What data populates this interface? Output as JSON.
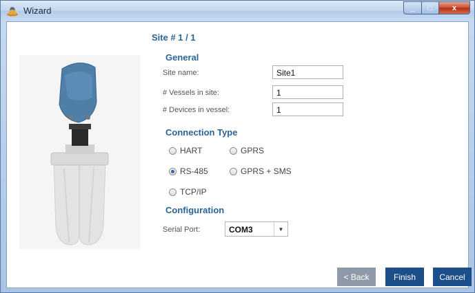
{
  "window": {
    "title": "Wizard",
    "close_glyph": "x",
    "maximize_glyph": "□",
    "minimize_glyph": "_"
  },
  "site_title": "Site # 1 / 1",
  "general": {
    "heading": "General",
    "site_name_label": "Site name:",
    "site_name_value": "Site1",
    "vessels_label": "# Vessels in site:",
    "vessels_value": "1",
    "devices_label": "# Devices in vessel:",
    "devices_value": "1"
  },
  "connection": {
    "heading": "Connection Type",
    "options": [
      {
        "label": "HART",
        "selected": false
      },
      {
        "label": "GPRS",
        "selected": false
      },
      {
        "label": "RS-485",
        "selected": true
      },
      {
        "label": "GPRS + SMS",
        "selected": false
      },
      {
        "label": "TCP/IP",
        "selected": false
      }
    ]
  },
  "configuration": {
    "heading": "Configuration",
    "serial_port_label": "Serial Port:",
    "serial_port_value": "COM3"
  },
  "buttons": {
    "back": "< Back",
    "finish": "Finish",
    "cancel": "Cancel"
  },
  "colors": {
    "accent": "#2a6496",
    "button": "#1c4f8a",
    "button_disabled": "#8e9aa8"
  },
  "icons": {
    "app": "wizard-hat-icon",
    "device": "radar-level-sensor-photo"
  }
}
